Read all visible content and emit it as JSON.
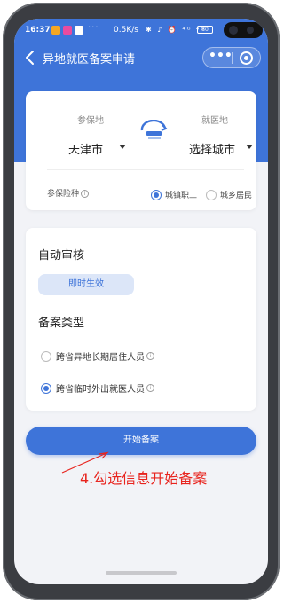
{
  "status_bar": {
    "time": "16:37",
    "dots": "···",
    "speed": "0.5K/s",
    "icons": "✱ ♪ ⏰ ⁴ᴳ ⁴ᴳ",
    "battery": "80"
  },
  "navbar": {
    "title": "异地就医备案申请",
    "more_label": "•••"
  },
  "location_card": {
    "insured_label": "参保地",
    "medical_label": "就医地",
    "insured_city": "天津市",
    "medical_city": "选择城市",
    "insurance_type_label": "参保险种",
    "info_glyph": "i",
    "insurance_options": [
      {
        "label": "城镇职工",
        "selected": true
      },
      {
        "label": "城乡居民",
        "selected": false
      }
    ]
  },
  "review_card": {
    "auto_review_title": "自动审核",
    "effect_label": "即时生效",
    "record_type_title": "备案类型",
    "record_options": [
      {
        "label": "跨省异地长期居住人员",
        "selected": false
      },
      {
        "label": "跨省临时外出就医人员",
        "selected": true
      }
    ]
  },
  "start_button_label": "开始备案",
  "annotation_text": "4.勾选信息开始备案",
  "colors": {
    "primary": "#3e74d9",
    "annotation": "#e8231d",
    "background": "#f2f3f7"
  }
}
